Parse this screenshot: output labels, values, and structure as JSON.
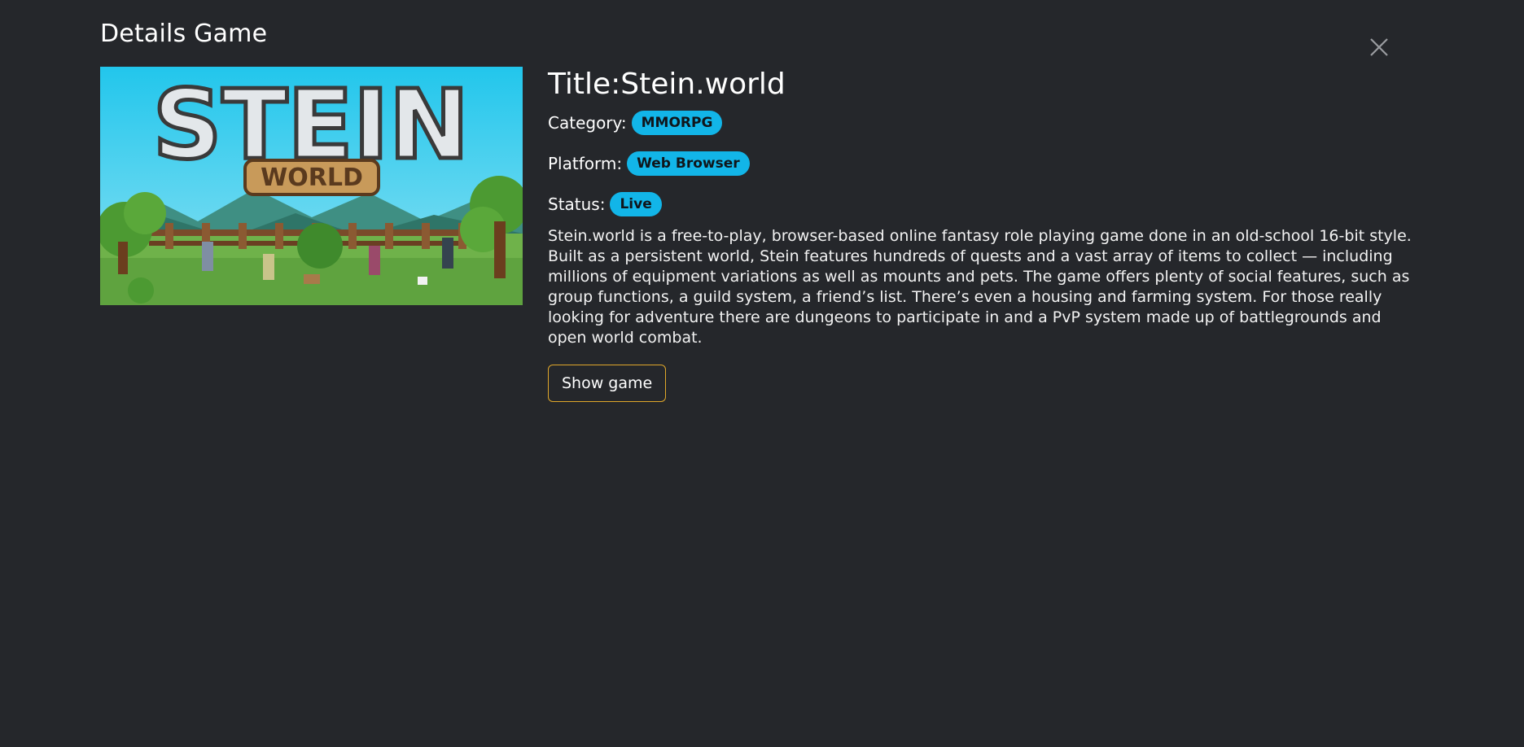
{
  "modal": {
    "title": "Details Game",
    "close_icon": "close-icon"
  },
  "game": {
    "cover_logo_top": "STEIN",
    "cover_logo_bottom": "WORLD",
    "title_text": "Title:Stein.world",
    "category_label": "Category:",
    "category": "MMORPG",
    "platform_label": "Platform:",
    "platform": "Web Browser",
    "status_label": "Status:",
    "status": "Live",
    "description": "Stein.world is a free-to-play, browser-based online fantasy role playing game done in an old-school 16-bit style. Built as a persistent world, Stein features hundreds of quests and a vast array of items to collect — including millions of equipment variations as well as mounts and pets. The game offers plenty of social features, such as group functions, a guild system, a friend’s list. There’s even a housing and farming system. For those really looking for adventure there are dungeons to participate in and a PvP system made up of battlegrounds and open world combat.",
    "show_button": "Show game"
  },
  "colors": {
    "background": "#25272b",
    "badge": "#12b5e8",
    "button_border": "#e0a72a"
  }
}
